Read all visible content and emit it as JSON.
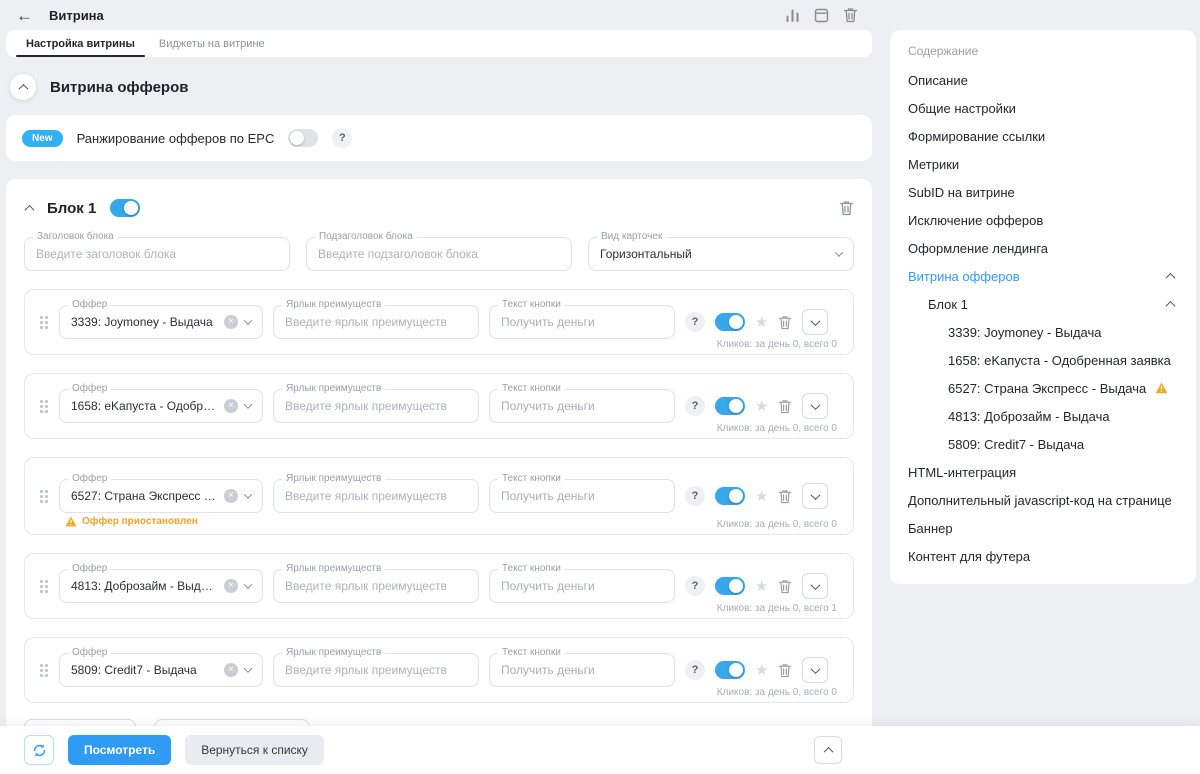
{
  "colors": {
    "accent": "#2f9bf4",
    "toggle_on": "#35a7ea",
    "warning": "#f5a623",
    "badge": "#2fb1f3"
  },
  "header": {
    "title": "Витрина"
  },
  "tabs": {
    "settings": "Настройка витрины",
    "widgets": "Виджеты на витрине"
  },
  "section": {
    "title": "Витрина офферов"
  },
  "epc": {
    "badge": "New",
    "label": "Ранжирование офферов по EPC"
  },
  "block": {
    "title": "Блок 1",
    "header_label": "Заголовок блока",
    "header_placeholder": "Введите заголовок блока",
    "subheader_label": "Подзаголовок блока",
    "subheader_placeholder": "Введите подзаголовок блока",
    "card_view_label": "Вид карточек",
    "card_view_value": "Горизонтальный",
    "offer_label": "Оффер",
    "perks_label": "Ярлык преимуществ",
    "perks_placeholder": "Введите ярлык преимуществ",
    "button_text_label": "Текст кнопки",
    "button_text_value": "Получить деньги"
  },
  "offers": [
    {
      "name": "3339: Joymoney - Выдача",
      "clicks": "Кликов: за день 0, всего 0"
    },
    {
      "name": "1658: eKапуста - Одобренная заявка",
      "clicks": "Кликов: за день 0, всего 0"
    },
    {
      "name": "6527: Страна Экспресс - Выдача",
      "warning": "Оффер приостановлен",
      "clicks": "Кликов: за день 0, всего 0"
    },
    {
      "name": "4813: Доброзайм - Выдача",
      "clicks": "Кликов: за день 0, всего 1"
    },
    {
      "name": "5809: Credit7 - Выдача",
      "clicks": "Кликов: за день 0, всего 0"
    }
  ],
  "footer": {
    "preview": "Посмотреть",
    "back": "Вернуться к списку"
  },
  "sidebar": {
    "title": "Содержание",
    "items": [
      "Описание",
      "Общие настройки",
      "Формирование ссылки",
      "Метрики",
      "SubID на витрине",
      "Исключение офферов",
      "Оформление лендинга",
      "Витрина офферов",
      "Блок 1",
      "3339: Joymoney - Выдача",
      "1658: eKапуста - Одобренная заявка",
      "6527: Страна Экспресс - Выдача",
      "4813: Доброзайм - Выдача",
      "5809: Credit7 - Выдача",
      "HTML-интеграция",
      "Дополнительный javascript-код на странице",
      "Баннер",
      "Контент для футера"
    ]
  }
}
